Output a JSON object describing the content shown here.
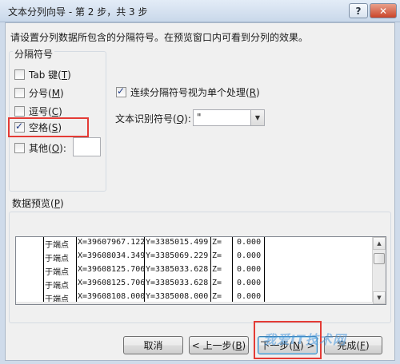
{
  "window": {
    "title": "文本分列向导 - 第 2 步，共 3 步",
    "help_glyph": "?",
    "close_glyph": "✕"
  },
  "instruction": "请设置分列数据所包含的分隔符号。在预览窗口内可看到分列的效果。",
  "delimiters": {
    "group_title": "分隔符号",
    "tab": {
      "label": "Tab 键(",
      "key": "T",
      "suffix": ")",
      "checked": false
    },
    "semicolon": {
      "label": "分号(",
      "key": "M",
      "suffix": ")",
      "checked": false
    },
    "comma": {
      "label": "逗号(",
      "key": "C",
      "suffix": ")",
      "checked": false
    },
    "space": {
      "label": "空格(",
      "key": "S",
      "suffix": ")",
      "checked": true
    },
    "other": {
      "label": "其他(",
      "key": "O",
      "suffix": "):",
      "checked": false,
      "value": ""
    }
  },
  "consecutive": {
    "label": "连续分隔符号视为单个处理(",
    "key": "R",
    "suffix": ")",
    "checked": true
  },
  "qualifier": {
    "label": "文本识别符号(",
    "key": "Q",
    "suffix": "):",
    "value": "\""
  },
  "preview": {
    "title": "数据预览(",
    "key": "P",
    "suffix": ")",
    "rows": [
      [
        "于端点",
        "X=39607967.122",
        "Y=3385015.499",
        "Z=",
        "0.000"
      ],
      [
        "于端点",
        "X=39608034.349",
        "Y=3385069.229",
        "Z=",
        "0.000"
      ],
      [
        "于端点",
        "X=39608125.706",
        "Y=3385033.628",
        "Z=",
        "0.000"
      ],
      [
        "于端点",
        "X=39608125.706",
        "Y=3385033.628",
        "Z=",
        "0.000"
      ],
      [
        "于端点",
        "X=39608108.000",
        "Y=3385008.000",
        "Z=",
        "0.000"
      ]
    ]
  },
  "buttons": {
    "cancel": "取消",
    "back": {
      "label": "< 上一步(",
      "key": "B",
      "suffix": ")"
    },
    "next": {
      "label": "下一步(",
      "key": "N",
      "suffix": ") >"
    },
    "finish": {
      "label": "完成(",
      "key": "F",
      "suffix": ")"
    }
  },
  "watermark": "我爱IT技术网",
  "colors": {
    "highlight_red": "#e43b35",
    "title_bar": "#c9d8ea",
    "dialog_bg": "#f0f0f0"
  }
}
